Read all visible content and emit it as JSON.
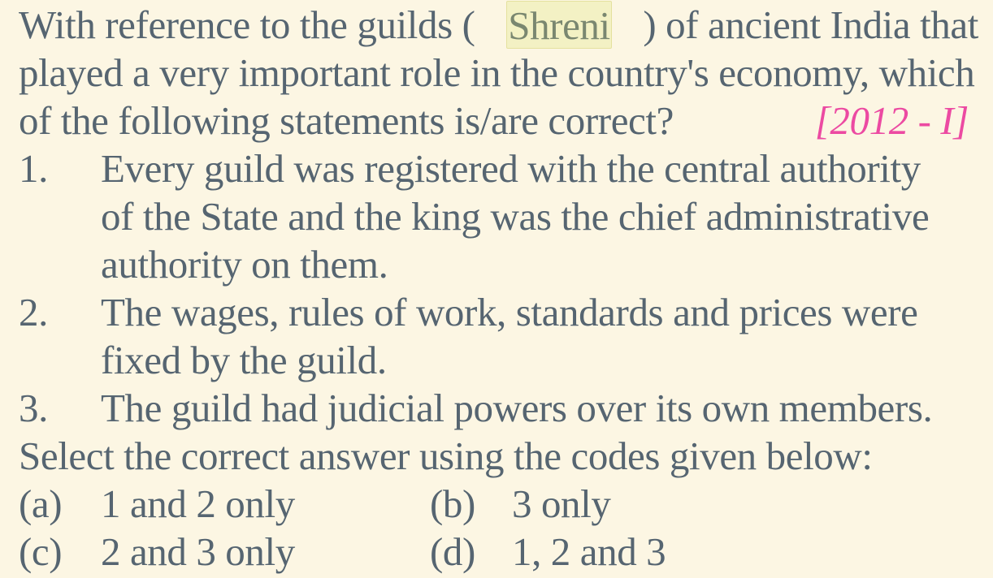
{
  "question": {
    "line1_before": "With reference to the guilds (",
    "highlight": "Shreni",
    "line1_after": ") of ancient India that",
    "line2": "played a very important role in the country's economy, which",
    "line3": "of the following statements is/are correct?",
    "year_tag": "[2012 - I]"
  },
  "statements": [
    {
      "number": "1.",
      "lines": [
        "Every guild was registered with the central authority",
        "of the State and the king was the chief administrative",
        "authority on them."
      ]
    },
    {
      "number": "2.",
      "lines": [
        "The wages, rules of work, standards and prices were",
        "fixed by the guild."
      ]
    },
    {
      "number": "3.",
      "lines": [
        "The guild had judicial powers over its own members."
      ]
    }
  ],
  "instruction": "Select the correct answer using the codes given below:",
  "options": [
    {
      "letter": "(a)",
      "text": "1 and 2 only"
    },
    {
      "letter": "(b)",
      "text": "3 only"
    },
    {
      "letter": "(c)",
      "text": "2 and 3 only"
    },
    {
      "letter": "(d)",
      "text": "1, 2 and 3"
    }
  ]
}
